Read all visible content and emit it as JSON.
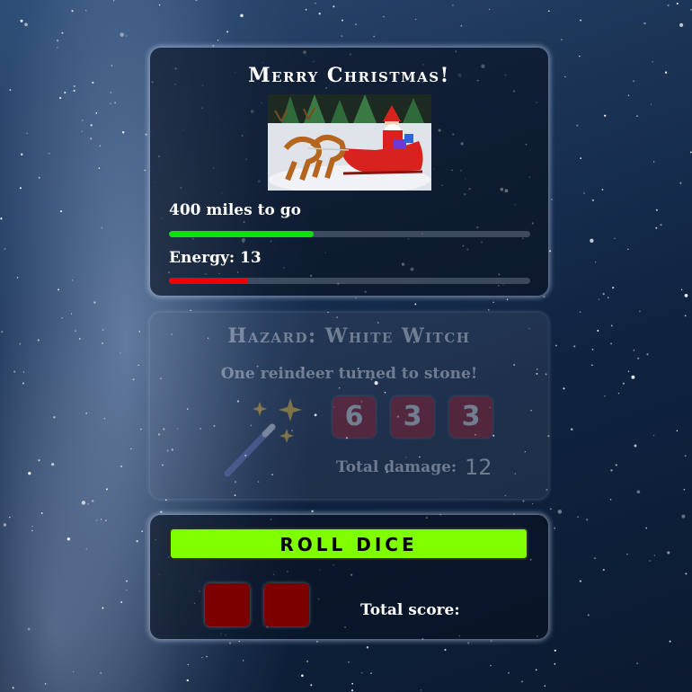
{
  "status": {
    "title": "Merry Christmas!",
    "miles_label": "400 miles to go",
    "miles_progress": 0.4,
    "energy_label": "Energy: 13",
    "energy_level": 0.22,
    "scene_image": "santa-sleigh-reindeer-image"
  },
  "hazard": {
    "title": "Hazard: White Witch",
    "description": "One reindeer turned to stone!",
    "icon": "magic-wand-icon",
    "dice": [
      "6",
      "3",
      "3"
    ],
    "damage_label": "Total damage:",
    "damage_value": "12"
  },
  "roll": {
    "button_label": "ROLL DICE",
    "dice": [
      "",
      ""
    ],
    "score_label": "Total score:"
  },
  "colors": {
    "miles_bar": "#12dd12",
    "energy_bar": "#ee0000",
    "roll_button": "#80ff00",
    "hazard_die": "#9a1d2e",
    "roll_die": "#7d0000"
  }
}
